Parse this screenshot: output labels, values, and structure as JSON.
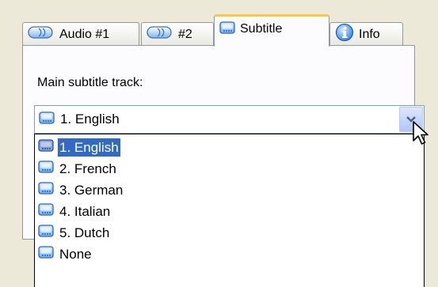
{
  "tabs": [
    {
      "label": "Audio #1",
      "icon": "speaker-icon"
    },
    {
      "label": "#2",
      "icon": "speaker-icon"
    },
    {
      "label": "Subtitle",
      "icon": "subtitle-icon"
    },
    {
      "label": "Info",
      "icon": "info-icon"
    }
  ],
  "active_tab": "Subtitle",
  "subtitle_panel": {
    "track_label": "Main subtitle track:",
    "selected_track": "1. English",
    "dropdown_open": true,
    "options": [
      {
        "label": "1. English",
        "selected": true
      },
      {
        "label": "2. French",
        "selected": false
      },
      {
        "label": "3. German",
        "selected": false
      },
      {
        "label": "4. Italian",
        "selected": false
      },
      {
        "label": "5. Dutch",
        "selected": false
      },
      {
        "label": "None",
        "selected": false
      }
    ]
  },
  "colors": {
    "selection": "#316ac5",
    "active_tab_accent": "#ffc83c",
    "panel_background": "#fcfcfe",
    "window_background": "#ece9d8"
  }
}
